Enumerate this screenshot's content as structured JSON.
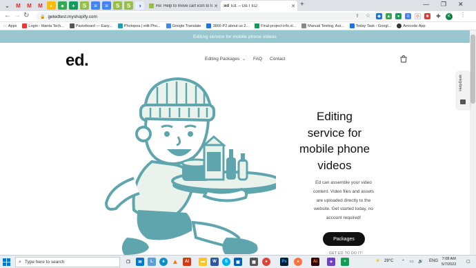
{
  "browser": {
    "tabs": [
      {
        "title": "Re: Help to move cart icon to to...",
        "active": false
      },
      {
        "title": "Ed. – GET ED",
        "active": true
      }
    ],
    "url": "getedtest.myshopify.com",
    "profile_initial": "K",
    "bookmarks": [
      {
        "label": "Apps",
        "color": "#4285f4"
      },
      {
        "label": "Login - Ittanta Tech...",
        "color": "#e53935"
      },
      {
        "label": "Pasteboard — Easy...",
        "color": "#555555"
      },
      {
        "label": "Photopea | edit Pho...",
        "color": "#17a2b8"
      },
      {
        "label": "Google Translate",
        "color": "#4285f4"
      },
      {
        "label": "3866-P2 about us 2...",
        "color": "#1a73e8"
      },
      {
        "label": "Final-project-info.xl...",
        "color": "#0f9d58"
      },
      {
        "label": "Manual Testing, Aut...",
        "color": "#888888"
      },
      {
        "label": "Today Task - Googl...",
        "color": "#1a73e8"
      },
      {
        "label": "Avocode App",
        "color": "#333333"
      }
    ]
  },
  "site": {
    "announcement": "Editing service for mobile phone videos",
    "logo": "ed.",
    "nav": {
      "packages": "Editing Packages",
      "faq": "FAQ",
      "contact": "Contact"
    },
    "helpdesk": "HelpDesk",
    "hero": {
      "title_lines": [
        "Editing",
        "service for",
        "mobile phone",
        "videos"
      ],
      "body_lines": [
        "Ed can assemble your video",
        "content. Video files and assets",
        "are uploaded directly to the",
        "website. Get started today, no",
        "account required!"
      ],
      "button": "Packages",
      "subtext": "GET ED TO DO IT!"
    }
  },
  "taskbar": {
    "search_placeholder": "Type here to search",
    "weather": "29°C",
    "language": "ENG",
    "time": "7:08 AM",
    "date": "5/7/2022"
  },
  "colors": {
    "announcement_bg": "#9ac7cf",
    "illustration": "#5fa5ad",
    "illustration_light": "#e9f3ec"
  }
}
